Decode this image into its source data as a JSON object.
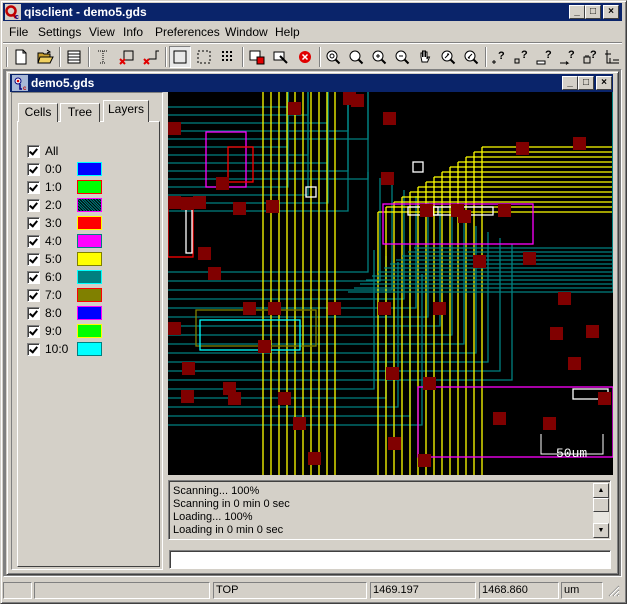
{
  "app": {
    "title": "qisclient - demo5.gds",
    "window_controls": {
      "minimize": "_",
      "maximize": "□",
      "close": "×"
    }
  },
  "menu": [
    "File",
    "Settings",
    "View",
    "Info",
    "Preferences",
    "Window",
    "Help"
  ],
  "toolbar": {
    "groups": [
      [
        "new-file-icon",
        "open-folder-icon"
      ],
      [
        "layers-stack-icon"
      ],
      [
        "text-cursor-icon",
        "delete-box-icon",
        "delete-path-icon"
      ],
      [
        "select-box-icon",
        "dashed-box-icon",
        "dotted-grid-icon"
      ],
      [
        "copy-cell-icon",
        "edit-cell-icon",
        "stop-icon"
      ],
      [
        "zoom-fit-icon",
        "zoom-icon",
        "zoom-in-icon",
        "zoom-out-icon",
        "pan-hand-icon",
        "zoom-prev-icon",
        "zoom-next-icon"
      ],
      [
        "query-point-icon",
        "query-box-icon",
        "query-ruler-icon",
        "query-arrow-icon",
        "query-cell-icon",
        "axes-icon"
      ]
    ]
  },
  "document": {
    "title": "demo5.gds",
    "tabs": [
      {
        "label": "Cells",
        "active": false
      },
      {
        "label": "Tree",
        "active": false
      },
      {
        "label": "Layers",
        "active": true
      }
    ],
    "all_label": "All",
    "all_checked": true,
    "layers": [
      {
        "name": "0:0",
        "checked": true,
        "fill": "#0000ff",
        "border": "#00ffff",
        "pattern": "solid"
      },
      {
        "name": "1:0",
        "checked": true,
        "fill": "#00ff00",
        "border": "#ff0000",
        "pattern": "solid"
      },
      {
        "name": "2:0",
        "checked": true,
        "fill": "#008080",
        "border": "#ff00ff",
        "pattern": "dotted"
      },
      {
        "name": "3:0",
        "checked": true,
        "fill": "#ff0000",
        "border": "#ffff00",
        "pattern": "solid"
      },
      {
        "name": "4:0",
        "checked": true,
        "fill": "#ff00ff",
        "border": "#008080",
        "pattern": "solid"
      },
      {
        "name": "5:0",
        "checked": true,
        "fill": "#ffff00",
        "border": "#808000",
        "pattern": "solid"
      },
      {
        "name": "6:0",
        "checked": true,
        "fill": "#008080",
        "border": "#00ffff",
        "pattern": "solid"
      },
      {
        "name": "7:0",
        "checked": true,
        "fill": "#808000",
        "border": "#ff0000",
        "pattern": "solid"
      },
      {
        "name": "8:0",
        "checked": true,
        "fill": "#0000ff",
        "border": "#ff00ff",
        "pattern": "solid"
      },
      {
        "name": "9:0",
        "checked": true,
        "fill": "#00ff00",
        "border": "#ffff00",
        "pattern": "solid"
      },
      {
        "name": "10:0",
        "checked": true,
        "fill": "#00ffff",
        "border": "#008080",
        "pattern": "solid"
      }
    ],
    "scale_bar_label": "50um",
    "layout_colors": {
      "background": "#000000",
      "metal": "#ffff00",
      "poly": "#008080",
      "contact": "#800000",
      "active": "#00ffff",
      "well": "#ff00ff",
      "diff": "#ff0000",
      "nwell": "#808000",
      "marker": "#ffffff"
    },
    "log": [
      "Scanning... 100%",
      "Scanning in 0 min 0 sec",
      "Loading... 100%",
      "Loading in 0 min 0 sec"
    ],
    "command_input": ""
  },
  "statusbar": {
    "panes": [
      "",
      "",
      "TOP",
      "1469.197",
      "1468.860",
      "um"
    ]
  }
}
